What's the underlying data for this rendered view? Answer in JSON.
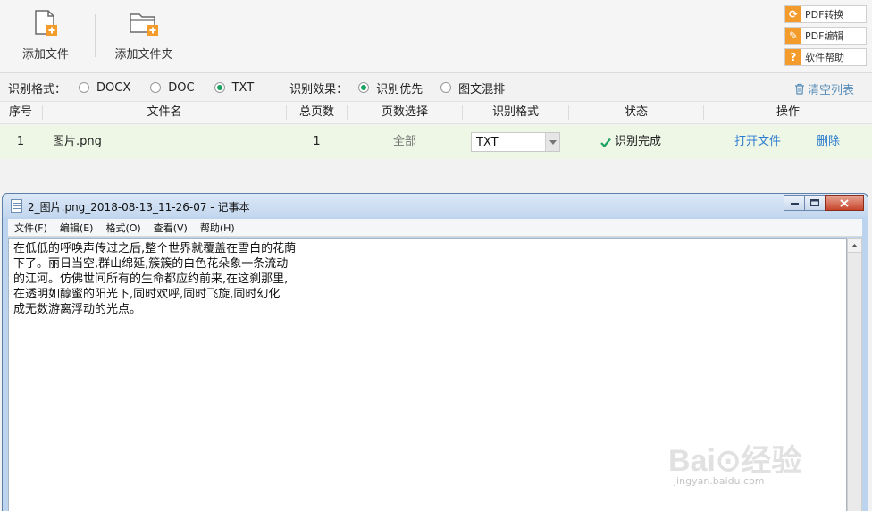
{
  "toolbar": {
    "add_file": "添加文件",
    "add_folder": "添加文件夹"
  },
  "side_buttons": [
    {
      "label": "PDF转换",
      "icon": "refresh-icon"
    },
    {
      "label": "PDF编辑",
      "icon": "pencil-icon"
    },
    {
      "label": "软件帮助",
      "icon": "question-icon"
    }
  ],
  "options": {
    "format_label": "识别格式：",
    "formats": [
      {
        "label": "DOCX",
        "selected": false
      },
      {
        "label": "DOC",
        "selected": false
      },
      {
        "label": "TXT",
        "selected": true
      }
    ],
    "effect_label": "识别效果：",
    "effects": [
      {
        "label": "识别优先",
        "selected": true
      },
      {
        "label": "图文混排",
        "selected": false
      }
    ],
    "clear_list": "清空列表"
  },
  "table": {
    "headers": [
      "序号",
      "文件名",
      "总页数",
      "页数选择",
      "识别格式",
      "状态",
      "操作"
    ],
    "rows": [
      {
        "index": "1",
        "filename": "图片.png",
        "pages": "1",
        "page_select": "全部",
        "format": "TXT",
        "status": "识别完成",
        "open": "打开文件",
        "delete": "删除"
      }
    ]
  },
  "notepad": {
    "title": "2_图片.png_2018-08-13_11-26-07 - 记事本",
    "menu": [
      "文件(F)",
      "编辑(E)",
      "格式(O)",
      "查看(V)",
      "帮助(H)"
    ],
    "content": "在低低的呼唤声传过之后,整个世界就覆盖在雪白的花荫\n下了。丽日当空,群山绵延,簇簇的白色花朵象一条流动\n的江河。仿佛世间所有的生命都应约前来,在这刹那里,\n在透明如醇蜜的阳光下,同时欢呼,同时飞旋,同时幻化\n成无数游离浮动的光点。"
  },
  "watermark": {
    "brand": "Bai⊙经验",
    "url": "jingyan.baidu.com"
  },
  "colors": {
    "accent_orange": "#f39c2b",
    "status_green": "#1aa260",
    "link_blue": "#2b7bd0",
    "row_highlight": "#eef7e6"
  }
}
